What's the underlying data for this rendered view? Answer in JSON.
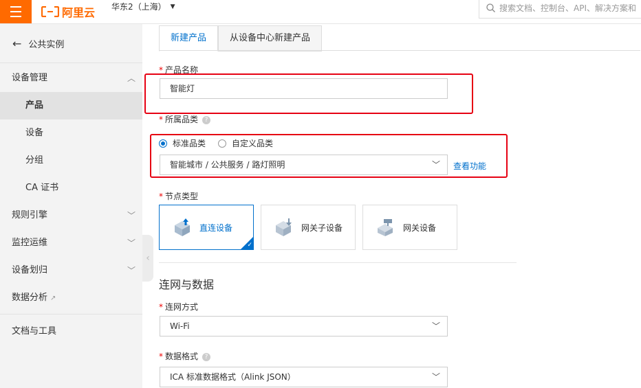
{
  "header": {
    "logo_text": "阿里云",
    "region": "华东2（上海）",
    "search_placeholder": "搜索文档、控制台、API、解决方案和"
  },
  "sidebar": {
    "back_label": "公共实例",
    "items": [
      {
        "label": "设备管理"
      },
      {
        "label": "产品"
      },
      {
        "label": "设备"
      },
      {
        "label": "分组"
      },
      {
        "label": "CA 证书"
      },
      {
        "label": "规则引擎"
      },
      {
        "label": "监控运维"
      },
      {
        "label": "设备划归"
      },
      {
        "label": "数据分析"
      },
      {
        "label": "文档与工具"
      }
    ]
  },
  "tabs": [
    {
      "label": "新建产品"
    },
    {
      "label": "从设备中心新建产品"
    }
  ],
  "form": {
    "required_mark": "*",
    "product_name_label": "产品名称",
    "product_name_value": "智能灯",
    "category_label": "所属品类",
    "category_options": [
      "标准品类",
      "自定义品类"
    ],
    "category_selected": "智能城市 / 公共服务 / 路灯照明",
    "view_function_link": "查看功能",
    "node_type_label": "节点类型",
    "node_types": [
      {
        "label": "直连设备"
      },
      {
        "label": "网关子设备"
      },
      {
        "label": "网关设备"
      }
    ],
    "section_title": "连网与数据",
    "network_label": "连网方式",
    "network_value": "Wi-Fi",
    "data_format_label": "数据格式",
    "data_format_value": "ICA 标准数据格式（Alink JSON）"
  },
  "colors": {
    "brand": "#ff6a00",
    "accent": "#0070cc",
    "highlight": "#e60012"
  }
}
